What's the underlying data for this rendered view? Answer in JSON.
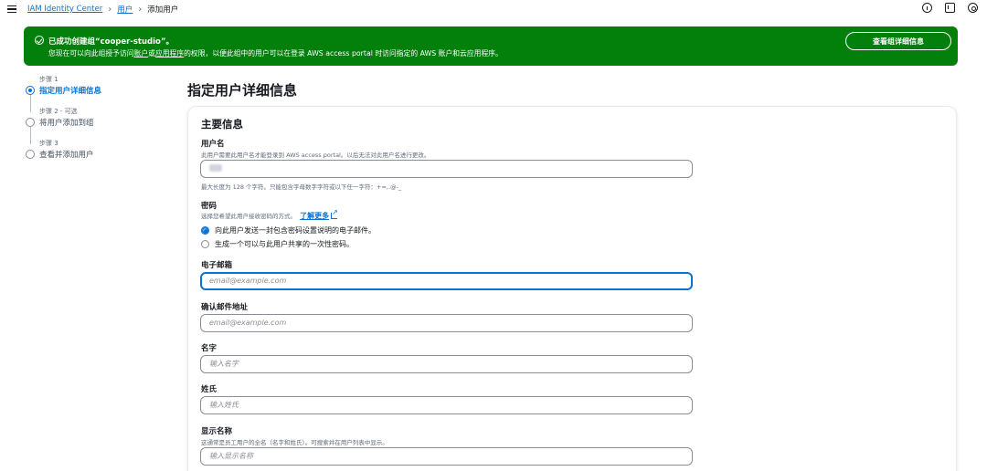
{
  "breadcrumb": {
    "items": [
      "IAM Identity Center",
      "用户"
    ],
    "current": "添加用户"
  },
  "flash": {
    "title": "已成功创建组“cooper-studio”。",
    "message_prefix": "您现在可以向此组授予访问",
    "link_accounts": "账户",
    "message_or": "或",
    "link_apps": "应用程序",
    "message_suffix": "的权限，以便此组中的用户可以在登录 AWS access portal 时访问指定的 AWS 账户和云应用程序。",
    "button_label": "查看组详细信息",
    "color": "#037f0c"
  },
  "steps": [
    {
      "num": "步骤 1",
      "label": "指定用户详细信息",
      "active": true
    },
    {
      "num": "步骤 2 - 可选",
      "label": "将用户添加到组",
      "active": false
    },
    {
      "num": "步骤 3",
      "label": "查看并添加用户",
      "active": false
    }
  ],
  "page": {
    "title": "指定用户详细信息"
  },
  "form": {
    "section_title": "主要信息",
    "username": {
      "label": "用户名",
      "description": "此用户需要此用户名才能登录到 AWS access portal。以后无法对此用户名进行更改。",
      "hint": "最大长度为 128 个字符。只能包含字母数字字符或以下任一字符：+=,.@-_"
    },
    "password": {
      "label": "密码",
      "description": "选择您希望此用户接收密码的方式。",
      "learn_more": "了解更多",
      "options": [
        {
          "label": "向此用户发送一封包含密码设置说明的电子邮件。",
          "checked": true
        },
        {
          "label": "生成一个可以与此用户共享的一次性密码。",
          "checked": false
        }
      ]
    },
    "email": {
      "label": "电子邮箱",
      "placeholder": "email@example.com"
    },
    "confirm_email": {
      "label": "确认邮件地址",
      "placeholder": "email@example.com"
    },
    "first_name": {
      "label": "名字",
      "placeholder": "输入名字"
    },
    "last_name": {
      "label": "姓氏",
      "placeholder": "输入姓氏"
    },
    "display_name": {
      "label": "显示名称",
      "description": "这通常是员工用户的全名（名字和姓氏）。可搜索并在用户列表中显示。",
      "placeholder": "输入显示名称"
    }
  },
  "colors": {
    "accent": "#0972d3",
    "success": "#037f0c"
  }
}
